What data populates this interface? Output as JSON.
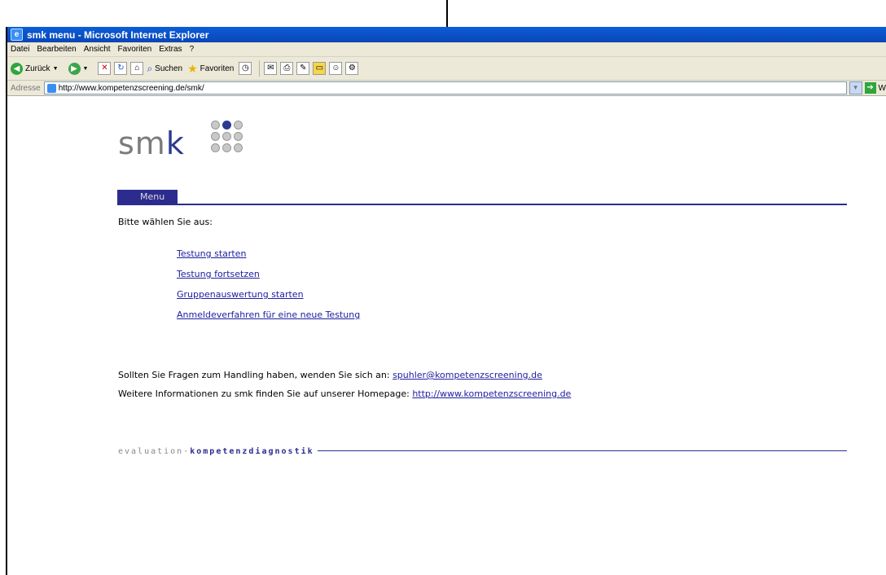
{
  "window": {
    "title": "smk menu - Microsoft Internet Explorer"
  },
  "menubar": {
    "items": [
      "Datei",
      "Bearbeiten",
      "Ansicht",
      "Favoriten",
      "Extras",
      "?"
    ]
  },
  "toolbar": {
    "back_label": "Zurück",
    "search_label": "Suchen",
    "favorites_label": "Favoriten"
  },
  "addressbar": {
    "label": "Adresse",
    "url": "http://www.kompetenzscreening.de/smk/",
    "go_label": "W"
  },
  "page": {
    "logo_text": "sm",
    "logo_k": "k",
    "menu_tab": "Menu",
    "intro": "Bitte wählen Sie aus:",
    "links": [
      "Testung starten",
      "Testung fortsetzen",
      "Gruppenauswertung starten",
      "Anmeldeverfahren für eine neue Testung"
    ],
    "contact_text": "Sollten Sie Fragen zum Handling haben, wenden Sie sich an: ",
    "contact_email": "spuhler@kompetenzscreening.de",
    "info_text": "Weitere Informationen zu smk finden Sie auf unserer Homepage: ",
    "info_url": "http://www.kompetenzscreening.de",
    "footer_eval": "evaluation·",
    "footer_kd": "kompetenzdiagnostik"
  }
}
